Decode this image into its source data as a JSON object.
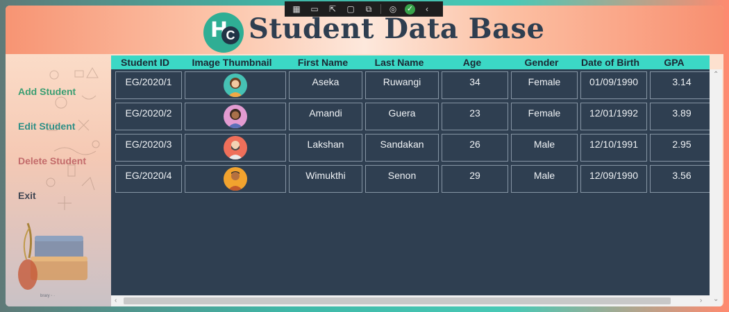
{
  "app": {
    "title": "Student Data Base",
    "logo_text": "H",
    "logo_badge": "C"
  },
  "toolbar": {
    "icons": [
      "select-element-icon",
      "camera-icon",
      "pointer-icon",
      "frame-icon",
      "hot-reload-icon",
      "track-focus-icon",
      "binding-failures-icon",
      "collapse-icon"
    ]
  },
  "sidebar": {
    "add": "Add Student",
    "edit": "Edit Student",
    "delete": "Delete Student",
    "exit": "Exit",
    "colors": {
      "add": "#3a9e72",
      "edit": "#2f8f86",
      "delete": "#c36b6b",
      "exit": "#404652"
    }
  },
  "grid": {
    "columns": [
      "Student ID",
      "Image Thumbnail",
      "First Name",
      "Last Name",
      "Age",
      "Gender",
      "Date of Birth",
      "GPA"
    ],
    "rows": [
      {
        "id": "EG/2020/1",
        "avatar": "female-avatar-1",
        "first": "Aseka",
        "last": "Ruwangi",
        "age": "34",
        "gender": "Female",
        "dob": "01/09/1990",
        "gpa": "3.14"
      },
      {
        "id": "EG/2020/2",
        "avatar": "female-avatar-2",
        "first": "Amandi",
        "last": "Guera",
        "age": "23",
        "gender": "Female",
        "dob": "12/01/1992",
        "gpa": "3.89"
      },
      {
        "id": "EG/2020/3",
        "avatar": "male-avatar-1",
        "first": "Lakshan",
        "last": "Sandakan",
        "age": "26",
        "gender": "Male",
        "dob": "12/10/1991",
        "gpa": "2.95"
      },
      {
        "id": "EG/2020/4",
        "avatar": "male-avatar-2",
        "first": "Wimukthi",
        "last": "Senon",
        "age": "29",
        "gender": "Male",
        "dob": "12/09/1990",
        "gpa": "3.56"
      }
    ]
  },
  "colors": {
    "header_bg": "#3bd8c5",
    "grid_bg": "#2f3f51",
    "title": "#2e3e50"
  }
}
